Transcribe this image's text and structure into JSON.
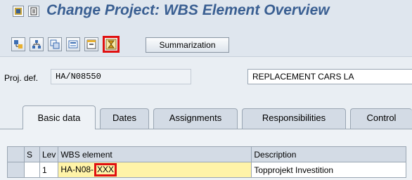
{
  "window": {
    "title": "Change Project: WBS Element Overview"
  },
  "toolbar": {
    "summarization_label": "Summarization"
  },
  "header": {
    "proj_def_label": "Proj. def.",
    "proj_def_value": "HA/N08550",
    "proj_def_description": "REPLACEMENT CARS LA"
  },
  "tabs": [
    {
      "label": "Basic data",
      "active": true
    },
    {
      "label": "Dates",
      "active": false
    },
    {
      "label": "Assignments",
      "active": false
    },
    {
      "label": "Responsibilities",
      "active": false
    },
    {
      "label": "Control",
      "active": false
    }
  ],
  "grid": {
    "columns": {
      "s": "S",
      "lev": "Lev",
      "wbs": "WBS element",
      "desc": "Description"
    },
    "rows": [
      {
        "lev": "1",
        "wbs_prefix": "HA-N08-",
        "wbs_highlight": "XXX",
        "desc": "Topprojekt Investition"
      }
    ]
  },
  "colors": {
    "title": "#3a5f92",
    "highlight_border": "#e01010",
    "wbs_cell": "#fff3a8"
  }
}
